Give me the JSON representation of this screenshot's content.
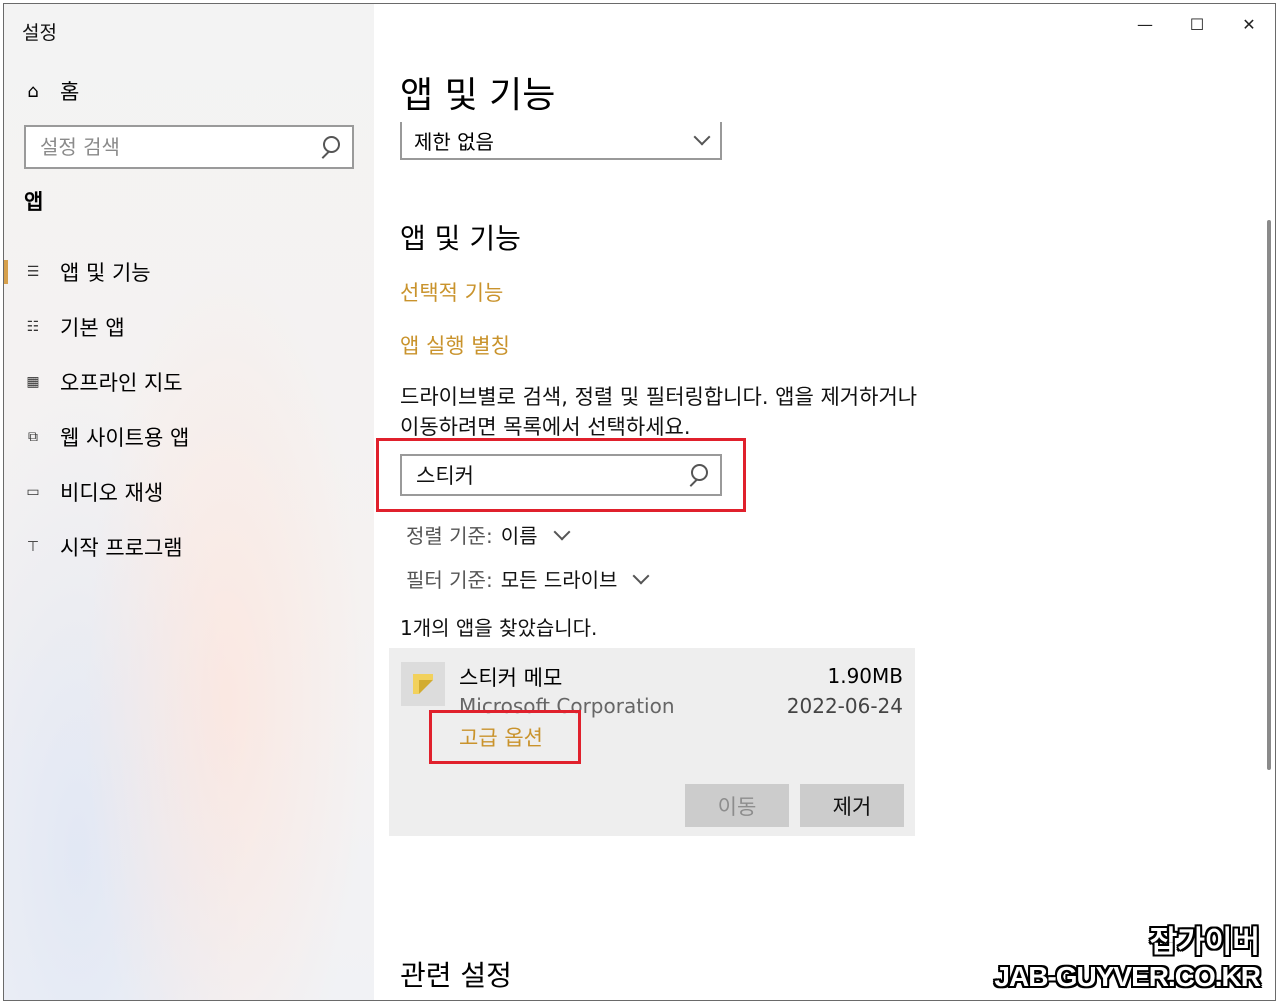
{
  "window": {
    "title": "설정",
    "minimize": "—",
    "maximize": "☐",
    "close": "✕"
  },
  "sidebar": {
    "home_label": "홈",
    "search_placeholder": "설정 검색",
    "section": "앱",
    "items": [
      {
        "label": "앱 및 기능",
        "icon": "apps-features-icon",
        "active": true
      },
      {
        "label": "기본 앱",
        "icon": "default-apps-icon",
        "active": false
      },
      {
        "label": "오프라인 지도",
        "icon": "offline-maps-icon",
        "active": false
      },
      {
        "label": "웹 사이트용 앱",
        "icon": "apps-for-websites-icon",
        "active": false
      },
      {
        "label": "비디오 재생",
        "icon": "video-playback-icon",
        "active": false
      },
      {
        "label": "시작 프로그램",
        "icon": "startup-icon",
        "active": false
      }
    ]
  },
  "main": {
    "page_title": "앱 및 기능",
    "source_select_value": "제한 없음",
    "sub_title": "앱 및 기능",
    "link_optional": "선택적 기능",
    "link_aliases": "앱 실행 별칭",
    "description": "드라이브별로 검색, 정렬 및 필터링합니다. 앱을 제거하거나 이동하려면 목록에서 선택하세요.",
    "search_value": "스티커",
    "sort_label": "정렬 기준:",
    "sort_value": "이름",
    "filter_label": "필터 기준:",
    "filter_value": "모든 드라이브",
    "found_text": "1개의 앱을 찾았습니다.",
    "app": {
      "name": "스티커 메모",
      "publisher": "Microsoft Corporation",
      "size": "1.90MB",
      "date": "2022-06-24",
      "advanced": "고급 옵션",
      "move_button": "이동",
      "remove_button": "제거"
    },
    "related": "관련 설정"
  },
  "watermark": {
    "line1": "잡가이버",
    "line2": "JAB-GUYVER.CO.KR"
  },
  "colors": {
    "accent": "#c9932c",
    "highlight_box": "#e0202c",
    "sidebar_indicator": "#d6a04c"
  }
}
